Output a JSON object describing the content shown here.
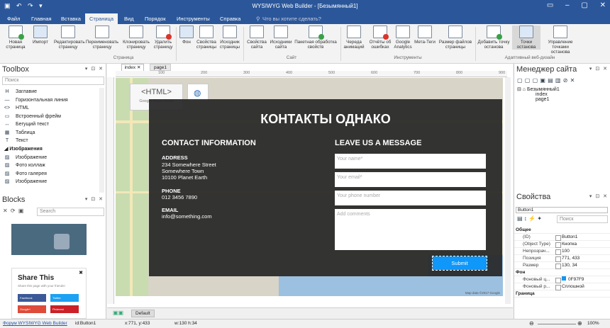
{
  "window": {
    "title": "WYSIWYG Web Builder - [Безымянный1]"
  },
  "menu": [
    "Файл",
    "Главная",
    "Вставка",
    "Страница",
    "Вид",
    "Порядок",
    "Инструменты",
    "Справка"
  ],
  "menu_active": "Страница",
  "tell_me": "Что вы хотите сделать?",
  "ribbon": {
    "buttons": [
      "Новая страница",
      "Импорт",
      "Редактировать страницу",
      "Переименовать страницу",
      "Клонировать страницу",
      "Удалить страницу",
      "Фон",
      "Свойства страницы",
      "Исходник страницы",
      "Свойства сайта",
      "Исходники сайта",
      "Пакетная обработка свойств",
      "Череда анимаций",
      "Отчёты об ошибках",
      "Google Analytics",
      "Мета-Теги",
      "Размер файлов страницы",
      "Добавить точку останова",
      "Точки останова",
      "Управление точками останова"
    ],
    "groups": [
      "Страница",
      "Сайт",
      "Инструменты",
      "Адаптивный веб-дизайн"
    ]
  },
  "toolbox": {
    "title": "Toolbox",
    "search_placeholder": "Поиск",
    "items": [
      "Заглавие",
      "Горизонтальная линия",
      "HTML",
      "Встроенный фрейм",
      "Бегущий текст",
      "Таблица",
      "Текст"
    ],
    "category": "Изображения",
    "image_items": [
      "Изображение",
      "Фото коллаж",
      "Фото галерея",
      "Изображение"
    ]
  },
  "blocks": {
    "title": "Blocks",
    "search_placeholder": "Search",
    "share_title": "Share This",
    "share_sub": "Share this page with your friends!",
    "share_buttons": [
      "Facebook",
      "Twitter",
      "Google+",
      "Pinterest"
    ]
  },
  "editor": {
    "tabs": [
      "index",
      "page1"
    ],
    "ruler_marks": [
      "100",
      "200",
      "300",
      "400",
      "500",
      "600",
      "700",
      "800",
      "900"
    ],
    "html_widget": "<HTML>",
    "html_widget_sub": "Google Maps Script",
    "footer_tab": "Default",
    "map_credit": "Map data ©2017 Google"
  },
  "contact": {
    "heading": "КОНТАКТЫ ОДНАКО",
    "left_title": "CONTACT INFORMATION",
    "address_label": "ADDRESS",
    "address_lines": [
      "234 Somewhere Street",
      "Somewhere Town",
      "10100 Planet Earth"
    ],
    "phone_label": "PHONE",
    "phone": "012 3456 7890",
    "email_label": "EMAIL",
    "email": "info@something.com",
    "right_title": "LEAVE US A MESSAGE",
    "name_placeholder": "Your name*",
    "email_placeholder": "Your email*",
    "phone_placeholder": "Your phone number",
    "comments_placeholder": "Add comments",
    "submit": "Submit",
    "submit_color": "#0F97F9"
  },
  "sitemgr": {
    "title": "Менеджер сайта",
    "root": "Безымянный1",
    "pages": [
      "index",
      "page1"
    ]
  },
  "props": {
    "title": "Свойства",
    "object": "Button1",
    "search_placeholder": "Поиск",
    "section1": "Общее",
    "rows": [
      {
        "k": "(ID)",
        "v": "Button1"
      },
      {
        "k": "(Object Type)",
        "v": "Кнопка"
      },
      {
        "k": "Непрозрач...",
        "v": "100"
      },
      {
        "k": "Позиция",
        "v": "771, 433"
      },
      {
        "k": "Размер",
        "v": "130, 34"
      }
    ],
    "section2": "Фон",
    "rows2": [
      {
        "k": "Фоновый ц...",
        "v": "0F97F9"
      },
      {
        "k": "Фоновый р...",
        "v": "Сплошной"
      }
    ],
    "section3": "Граница"
  },
  "status": {
    "link": "Форум WYSIWYG Web Builder",
    "id": "id:Button1",
    "xy": "x:771, y:433",
    "wh": "w:130 h:34",
    "zoom": "100%"
  }
}
